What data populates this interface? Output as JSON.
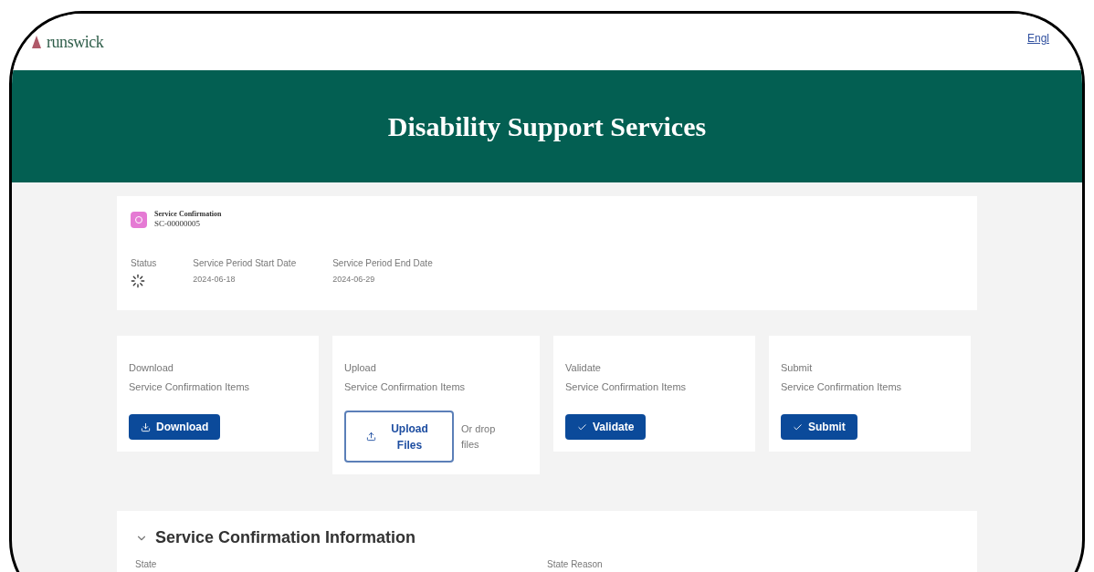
{
  "header": {
    "logo_text": "runswick",
    "language_link": "Engl"
  },
  "banner": {
    "title": "Disability Support Services"
  },
  "record": {
    "type": "Service Confirmation",
    "number": "SC-00000005",
    "fields": [
      {
        "label": "Status",
        "kind": "spinner"
      },
      {
        "label": "Service Period Start Date",
        "kind": "text",
        "value": "2024-06-18"
      },
      {
        "label": "Service Period End Date",
        "kind": "text",
        "value": "2024-06-29"
      }
    ]
  },
  "actions": [
    {
      "kind": "download",
      "title": "Download",
      "subtitle": "Service Confirmation Items",
      "button": "Download"
    },
    {
      "kind": "upload",
      "title": "Upload",
      "subtitle": "Service Confirmation Items",
      "button": "Upload Files",
      "hint": "Or drop files"
    },
    {
      "kind": "check",
      "title": "Validate",
      "subtitle": "Service Confirmation Items",
      "button": "Validate"
    },
    {
      "kind": "check",
      "title": "Submit",
      "subtitle": "Service Confirmation Items",
      "button": "Submit"
    }
  ],
  "section": {
    "title": "Service Confirmation Information",
    "expanded": true,
    "fields": [
      "State",
      "State Reason"
    ]
  }
}
